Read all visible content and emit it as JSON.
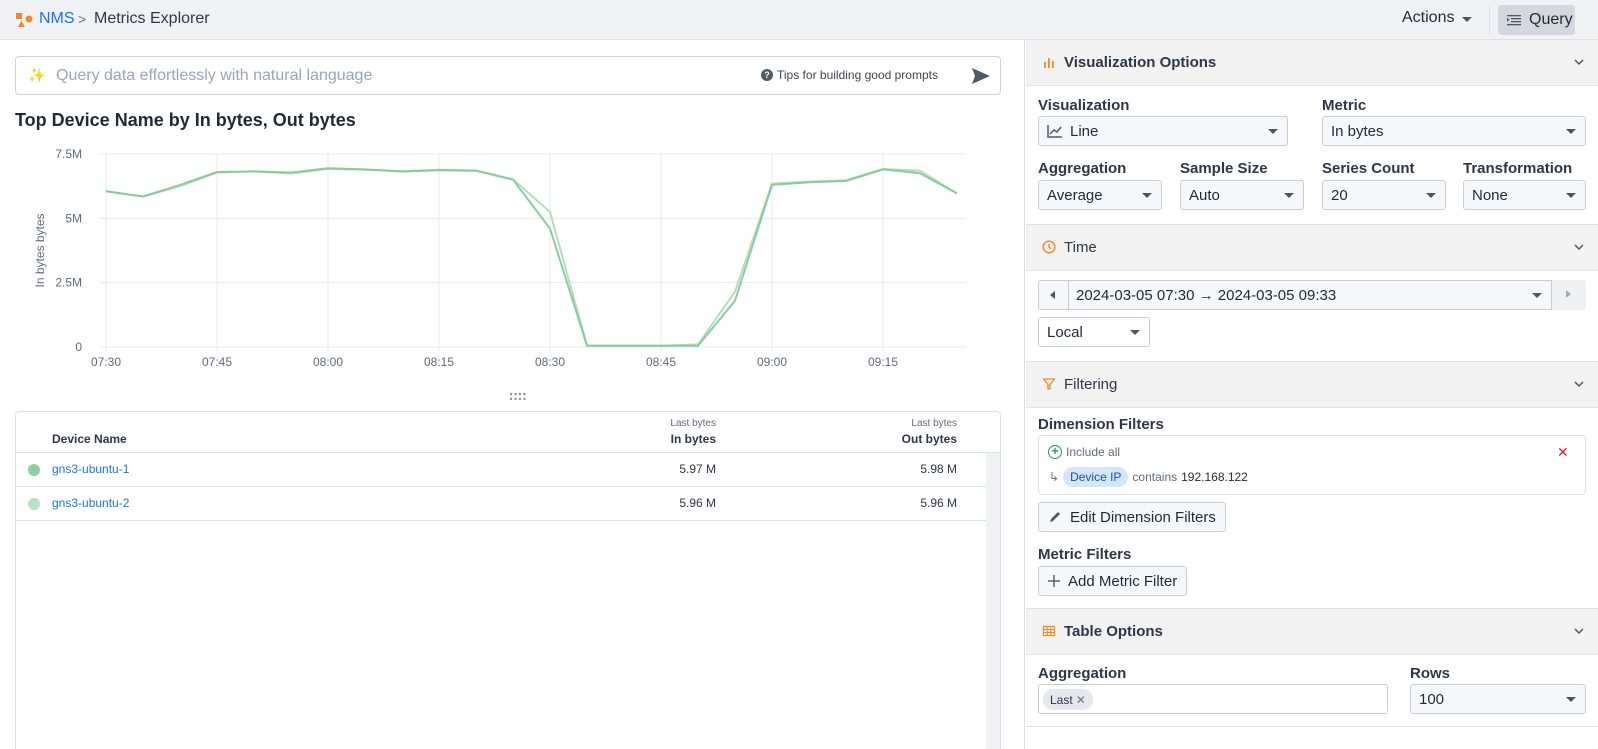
{
  "topbar": {
    "breadcrumb_root": "NMS",
    "breadcrumb_separator": ">",
    "breadcrumb_current": "Metrics Explorer",
    "actions_label": "Actions",
    "query_label": "Query"
  },
  "colors": {
    "accent": "#1a73e8",
    "brand_orange": "#f08a24",
    "series_1": "#7fc897",
    "series_2": "#a9dcb6",
    "remove_red": "#e02424"
  },
  "nlq": {
    "placeholder": "Query data effortlessly with natural language",
    "value": "",
    "tips_label": "Tips for building good prompts"
  },
  "chart_title": "Top Device Name by In bytes, Out bytes",
  "chart_data": {
    "type": "line",
    "title": "Top Device Name by In bytes, Out bytes",
    "xlabel": "",
    "ylabel": "In bytes bytes",
    "ylim": [
      0,
      7500000
    ],
    "yticks": [
      {
        "value": 0,
        "label": "0"
      },
      {
        "value": 2500000,
        "label": "2.5M"
      },
      {
        "value": 5000000,
        "label": "5M"
      },
      {
        "value": 7500000,
        "label": "7.5M"
      }
    ],
    "xticks": [
      "07:30",
      "07:45",
      "08:00",
      "08:15",
      "08:30",
      "08:45",
      "09:00",
      "09:15"
    ],
    "x": [
      "07:30",
      "07:35",
      "07:40",
      "07:45",
      "07:50",
      "07:55",
      "08:00",
      "08:05",
      "08:10",
      "08:15",
      "08:20",
      "08:25",
      "08:30",
      "08:35",
      "08:40",
      "08:45",
      "08:50",
      "08:55",
      "09:00",
      "09:05",
      "09:10",
      "09:15",
      "09:20",
      "09:25"
    ],
    "grid": true,
    "legend": "none",
    "series": [
      {
        "name": "gns3-ubuntu-1",
        "values": [
          6050000,
          5850000,
          6300000,
          6800000,
          6820000,
          6780000,
          6950000,
          6900000,
          6820000,
          6870000,
          6850000,
          6500000,
          4600000,
          50000,
          50000,
          50000,
          50000,
          1800000,
          6300000,
          6400000,
          6450000,
          6900000,
          6750000,
          5970000
        ]
      },
      {
        "name": "gns3-ubuntu-2",
        "values": [
          6050000,
          5850000,
          6250000,
          6780000,
          6830000,
          6740000,
          6930000,
          6890000,
          6830000,
          6890000,
          6860000,
          6520000,
          5250000,
          50000,
          50000,
          50000,
          100000,
          2150000,
          6350000,
          6420000,
          6480000,
          6920000,
          6850000,
          5960000
        ]
      }
    ]
  },
  "table": {
    "columns": [
      {
        "label": "Device Name"
      },
      {
        "sub": "Last bytes",
        "label": "In bytes"
      },
      {
        "sub": "Last bytes",
        "label": "Out bytes"
      }
    ],
    "rows": [
      {
        "name": "gns3-ubuntu-1",
        "in": "5.97 M",
        "out": "5.98 M"
      },
      {
        "name": "gns3-ubuntu-2",
        "in": "5.96 M",
        "out": "5.96 M"
      }
    ]
  },
  "panel": {
    "viz": {
      "title": "Visualization Options",
      "visualization_label": "Visualization",
      "visualization_value": "Line",
      "metric_label": "Metric",
      "metric_value": "In bytes",
      "aggregation_label": "Aggregation",
      "aggregation_value": "Average",
      "sample_label": "Sample Size",
      "sample_value": "Auto",
      "series_label": "Series Count",
      "series_value": "20",
      "transform_label": "Transformation",
      "transform_value": "None"
    },
    "time": {
      "title": "Time",
      "range": "2024-03-05 07:30 → 2024-03-05 09:33",
      "timezone": "Local"
    },
    "filtering": {
      "title": "Filtering",
      "dimension_label": "Dimension Filters",
      "include_all": "Include all",
      "remove_symbol": "✕",
      "filter_dimension": "Device IP",
      "filter_op": "contains",
      "filter_value": "192.168.122",
      "edit_button": "Edit Dimension Filters",
      "metric_label": "Metric Filters",
      "add_metric_button": "Add Metric Filter"
    },
    "table_options": {
      "title": "Table Options",
      "aggregation_label": "Aggregation",
      "aggregation_chip": "Last",
      "rows_label": "Rows",
      "rows_value": "100"
    }
  }
}
